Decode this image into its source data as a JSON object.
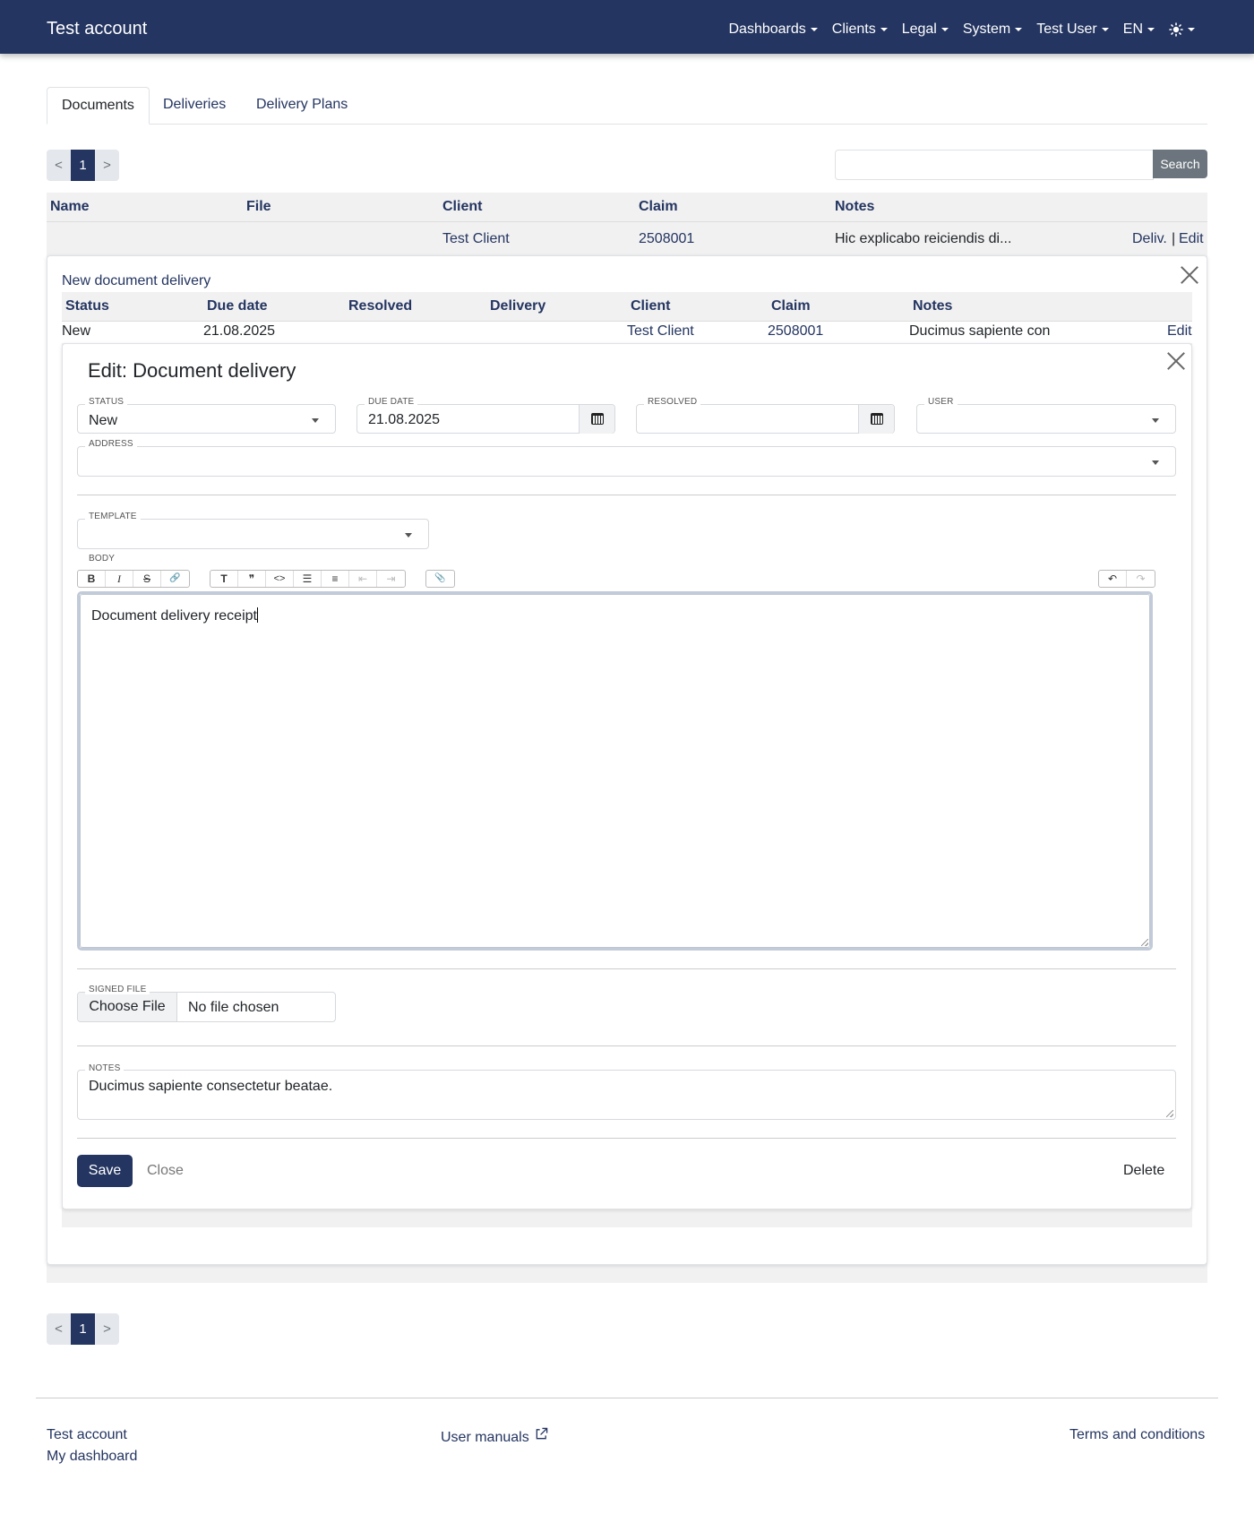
{
  "navbar": {
    "brand": "Test account",
    "items": [
      "Dashboards",
      "Clients",
      "Legal",
      "System",
      "Test User",
      "EN"
    ],
    "theme_icon": "sun-icon"
  },
  "tabs": [
    "Documents",
    "Deliveries",
    "Delivery Plans"
  ],
  "pager": {
    "prev": "<",
    "page": "1",
    "next": ">"
  },
  "search": {
    "button": "Search",
    "value": ""
  },
  "documents_table": {
    "headers": [
      "Name",
      "File",
      "Client",
      "Claim",
      "Notes"
    ],
    "row": {
      "name": "",
      "file": "",
      "client": "Test Client",
      "claim": "2508001",
      "notes": "Hic explicabo reiciendis di...",
      "deliv": "Deliv.",
      "sep": "|",
      "edit": "Edit"
    }
  },
  "delivery_panel": {
    "new_link": "New document delivery",
    "headers": [
      "Status",
      "Due date",
      "Resolved",
      "Delivery",
      "Client",
      "Claim",
      "Notes"
    ],
    "row": {
      "status": "New",
      "due": "21.08.2025",
      "resolved": "",
      "delivery": "",
      "client": "Test Client",
      "claim": "2508001",
      "notes": "Ducimus sapiente con",
      "edit": "Edit"
    }
  },
  "edit_form": {
    "title": "Edit: Document delivery",
    "status": {
      "label": "Status",
      "value": "New"
    },
    "due_date": {
      "label": "Due date",
      "value": "21.08.2025"
    },
    "resolved": {
      "label": "Resolved",
      "value": ""
    },
    "user": {
      "label": "User",
      "value": ""
    },
    "address": {
      "label": "Address",
      "value": ""
    },
    "template": {
      "label": "Template",
      "value": ""
    },
    "body": {
      "label": "Body",
      "text": "Document delivery receipt",
      "toolbar": {
        "format": [
          "B",
          "I",
          "S",
          "🔗"
        ],
        "blocks": [
          "T",
          "❞",
          "<>",
          "☰",
          "≡",
          "⇤",
          "⇥"
        ],
        "attach": "📎",
        "history": [
          "↶",
          "↷"
        ]
      }
    },
    "signed_file": {
      "label": "Signed file",
      "button": "Choose File",
      "status": "No file chosen"
    },
    "notes": {
      "label": "Notes",
      "value": "Ducimus sapiente consectetur beatae."
    },
    "save": "Save",
    "close": "Close",
    "delete": "Delete"
  },
  "footer": {
    "account": "Test account",
    "dashboard": "My dashboard",
    "manuals": "User manuals",
    "terms": "Terms and conditions"
  }
}
